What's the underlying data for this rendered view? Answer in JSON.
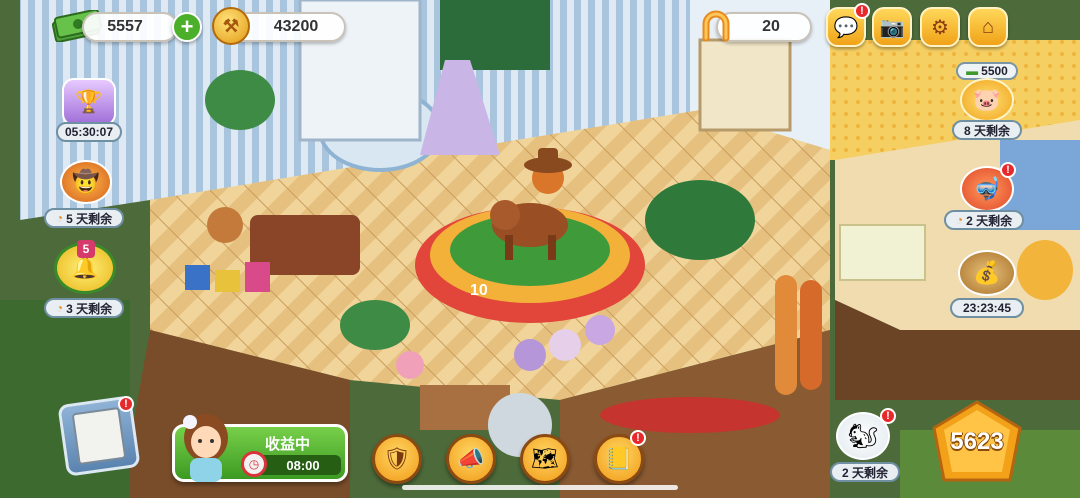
{
  "hud": {
    "cash_value": "5557",
    "coin_value": "43200",
    "horseshoe_value": "20",
    "bank_cash_value": "5500",
    "level_value": "5623"
  },
  "events": {
    "trophy_timer": "05:30:07",
    "cowboy_days_left": "5 天剩余",
    "bell_level": "5",
    "bell_days_left": "3 天剩余",
    "piggy_days_left": "8 天剩余",
    "goggles_days_left": "2 天剩余",
    "cash_pot_timer": "23:23:45",
    "squirrel_days_left": "2 天剩余"
  },
  "earning": {
    "status_label": "收益中",
    "timer": "08:00"
  },
  "colors": {
    "accent_orange": "#f0a318",
    "earning_green": "#4caf2a",
    "badge_red": "#e8282a",
    "floor": "#e8c78c"
  },
  "icons": {
    "cash": "cash-stack-icon",
    "coin": "gold-coin-icon",
    "horseshoe": "horseshoe-icon",
    "chat": "chat-icon",
    "camera": "camera-icon",
    "settings": "gear-icon",
    "home": "home-icon"
  }
}
